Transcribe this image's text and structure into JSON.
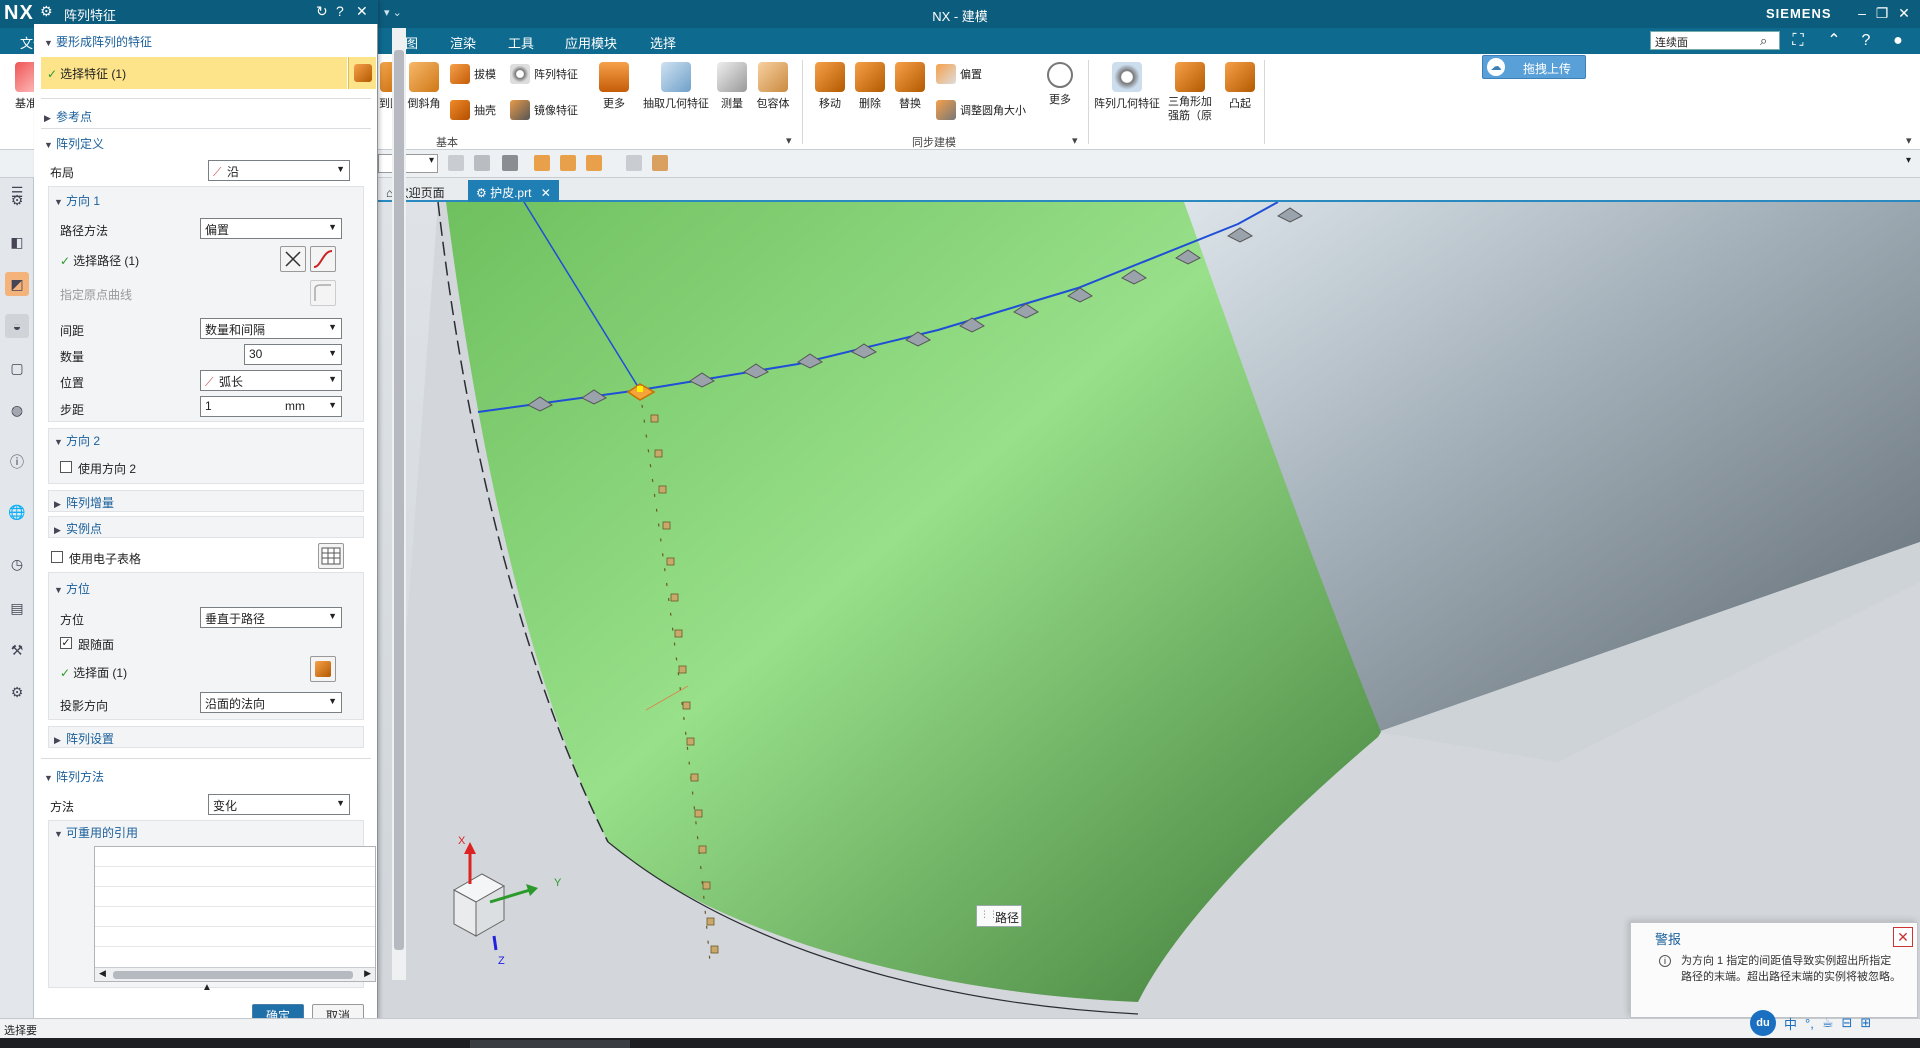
{
  "app": {
    "logo": "NX",
    "window_title": "NX - 建模",
    "brand": "SIEMENS",
    "quick_access": "▾ ⌄"
  },
  "menu": {
    "items": [
      "文件",
      "视图",
      "渲染",
      "工具",
      "应用模块",
      "选择"
    ],
    "search_value": "连续面"
  },
  "ribbon": {
    "left_partial": [
      "基准",
      "到圆",
      "倒斜角"
    ],
    "basic": [
      {
        "label": "拔模"
      },
      {
        "label": "阵列特征"
      },
      {
        "label": "抽壳"
      },
      {
        "label": "镜像特征"
      },
      {
        "label": "更多"
      },
      {
        "label": "抽取几何特征"
      },
      {
        "label": "测量"
      },
      {
        "label": "包容体"
      }
    ],
    "basic_group": "基本",
    "sync": [
      {
        "label": "移动"
      },
      {
        "label": "删除"
      },
      {
        "label": "替换"
      },
      {
        "label": "偏置"
      },
      {
        "label": "调整圆角大小"
      },
      {
        "label": "更多"
      }
    ],
    "sync_group": "同步建模",
    "right": [
      {
        "label": "阵列几何特征"
      },
      {
        "label": "三角形加强筋（原"
      },
      {
        "label": "凸起"
      }
    ],
    "upload_label": "拖拽上传"
  },
  "tabs": [
    {
      "label": "欢迎页面"
    },
    {
      "label": "护皮.prt",
      "close": "✕"
    }
  ],
  "dialog": {
    "title": "阵列特征",
    "title_buttons": [
      "↻",
      "?",
      "✕"
    ],
    "sec_features": "要形成阵列的特征",
    "select_feature": "选择特征 (1)",
    "sec_refpoint": "参考点",
    "sec_pattern_def": "阵列定义",
    "layout_label": "布局",
    "layout_value": "沿",
    "dir1": "方向 1",
    "path_method_label": "路径方法",
    "path_method_value": "偏置",
    "select_path": "选择路径 (1)",
    "origin_curve": "指定原点曲线",
    "spacing_label": "间距",
    "spacing_value": "数量和间隔",
    "count_label": "数量",
    "count_value": "30",
    "position_label": "位置",
    "position_value": "弧长",
    "pitch_label": "步距",
    "pitch_value": "1",
    "pitch_unit": "mm",
    "dir2": "方向 2",
    "use_dir2": "使用方向 2",
    "pattern_increment": "阵列增量",
    "instance_points": "实例点",
    "use_spreadsheet": "使用电子表格",
    "orientation": "方位",
    "orient_label": "方位",
    "orient_value": "垂直于路径",
    "follow_face": "跟随面",
    "select_face": "选择面 (1)",
    "projection_label": "投影方向",
    "projection_value": "沿面的法向",
    "pattern_settings": "阵列设置",
    "pattern_method": "阵列方法",
    "method_label": "方法",
    "method_value": "变化",
    "reusable_refs": "可重用的引用",
    "ok": "确定",
    "cancel": "取消"
  },
  "viewport": {
    "path_label": "路径",
    "axis_x": "X",
    "axis_y": "Y",
    "axis_z": "Z"
  },
  "alert": {
    "title": "警报",
    "message": "为方向 1 指定的间距值导致实例超出所指定路径的末端。超出路径末端的实例将被忽略。"
  },
  "status": {
    "text": "选择要"
  },
  "ime": {
    "badge": "du",
    "items": [
      "中",
      "°,",
      "☕",
      "⊟",
      "⊞"
    ]
  },
  "colors": {
    "title_bar": "#0c5d7d",
    "menu_bar": "#0e6a8f",
    "highlight": "#fde38a",
    "face_green": "#7ed07a",
    "path_blue": "#1f4fd6"
  }
}
